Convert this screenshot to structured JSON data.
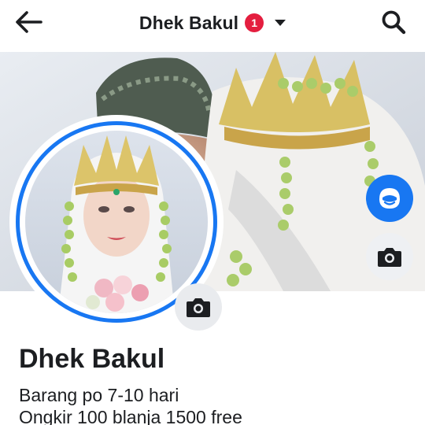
{
  "header": {
    "title": "Dhek Bakul",
    "badge_count": "1",
    "icons": {
      "back": "arrow-left-icon",
      "dropdown": "caret-down-icon",
      "search": "search-icon"
    }
  },
  "profile": {
    "name": "Dhek Bakul",
    "bio_lines": [
      "Barang po 7-10 hari",
      "Ongkir 100 blanja 1500 free"
    ]
  },
  "buttons": {
    "avatar_frame": "avatar-icon",
    "cover_camera": "camera-icon",
    "profile_camera": "camera-icon"
  },
  "colors": {
    "accent": "#1877f2",
    "badge": "#e41e3f",
    "text": "#1c1e21",
    "button_bg": "#e9ebee"
  }
}
